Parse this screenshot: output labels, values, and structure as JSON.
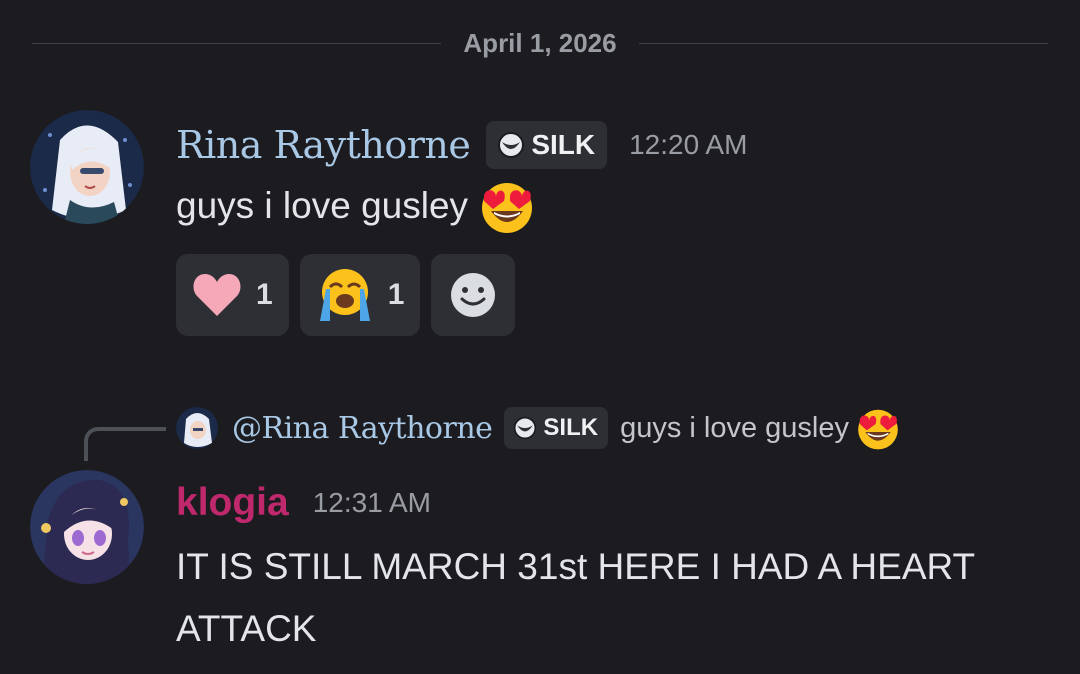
{
  "date_divider": "April 1, 2026",
  "message1": {
    "username": "Rina Raythorne",
    "tag": "SILK",
    "timestamp": "12:20 AM",
    "text": "guys i love gusley",
    "text_emoji": "heart-eyes-emoji",
    "reactions": [
      {
        "emoji": "heart-emoji",
        "count": "1"
      },
      {
        "emoji": "loudly-crying-emoji",
        "count": "1"
      }
    ],
    "add_reaction_icon": "add-reaction-icon"
  },
  "message2": {
    "reply": {
      "mention": "@Rina Raythorne",
      "tag": "SILK",
      "text": "guys i love gusley"
    },
    "username": "klogia",
    "timestamp": "12:31 AM",
    "text_line1": "IT IS STILL MARCH 31st HERE I HAD A HEART",
    "text_line2": "ATTACK"
  },
  "colors": {
    "background": "#1c1c20",
    "rina_name": "#a8c8e6",
    "klogia_name": "#c0286d",
    "tag_bg": "#2e2f35"
  }
}
